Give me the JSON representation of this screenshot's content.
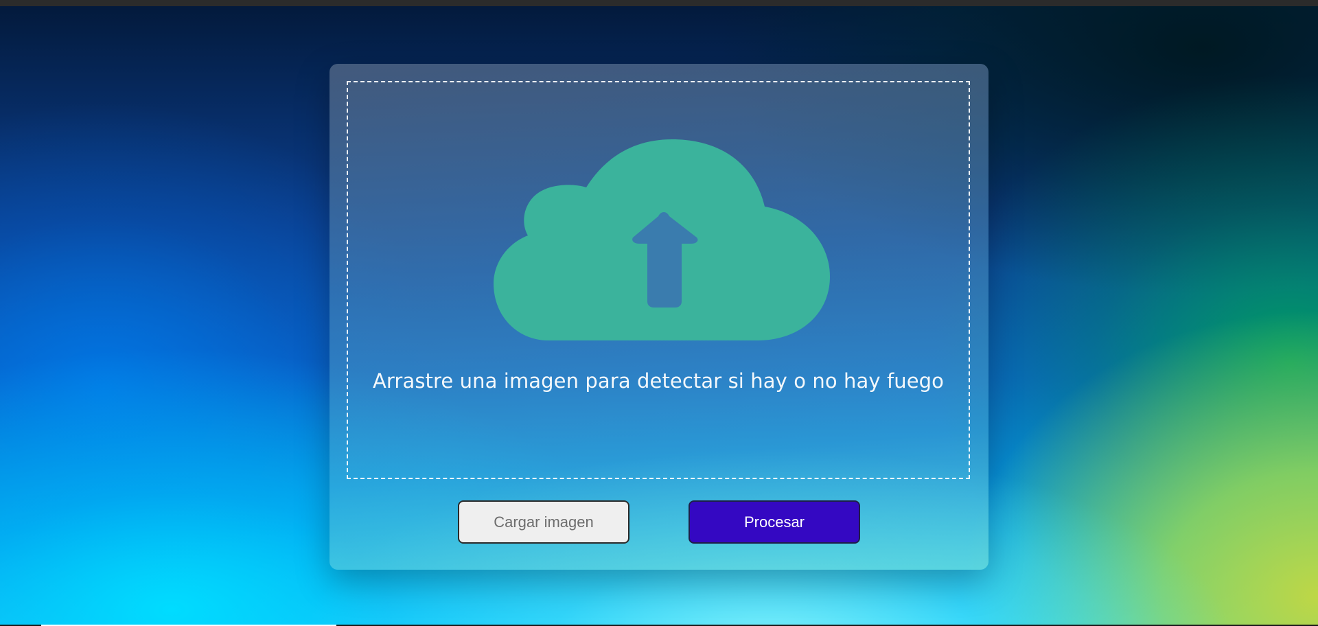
{
  "upload": {
    "drop_text": "Arrastre una imagen para detectar si hay o no hay fuego",
    "icon": "cloud-upload-icon"
  },
  "actions": {
    "load_label": "Cargar imagen",
    "process_label": "Procesar"
  },
  "colors": {
    "cloud": "#3bb39c",
    "process_button": "#3408c2",
    "load_button": "#efefef"
  }
}
